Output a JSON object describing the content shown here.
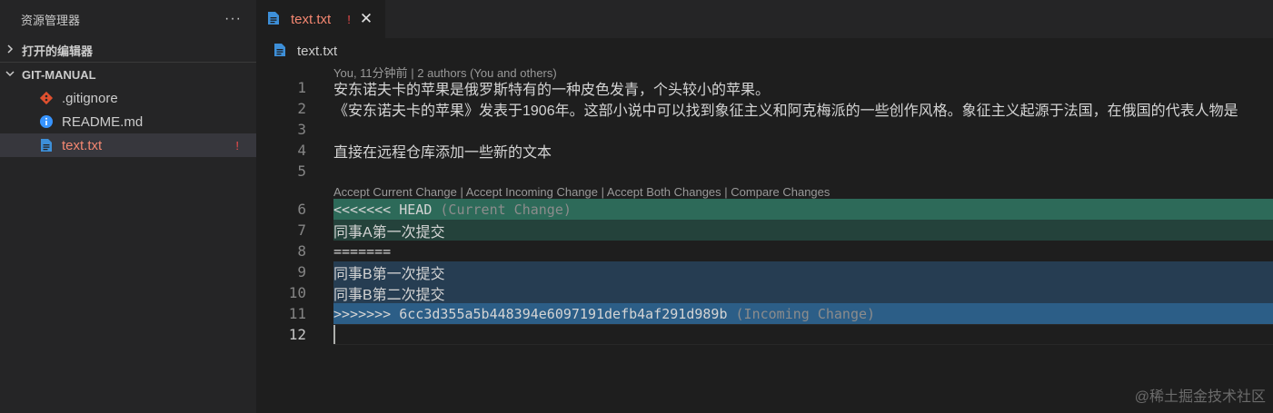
{
  "sidebar": {
    "title": "资源管理器",
    "more_label": "···",
    "open_editors": "打开的编辑器",
    "folder": "GIT-MANUAL",
    "files": [
      {
        "name": ".gitignore",
        "icon": "git-icon"
      },
      {
        "name": "README.md",
        "icon": "info-icon"
      },
      {
        "name": "text.txt",
        "icon": "file-icon",
        "status": "!"
      }
    ]
  },
  "tab": {
    "name": "text.txt",
    "status": "!",
    "close": "✕"
  },
  "breadcrumb": {
    "file": "text.txt"
  },
  "blame_lens": "You, 11分钟前 | 2 authors (You and others)",
  "conflict_lens": {
    "accept_current": "Accept Current Change",
    "accept_incoming": "Accept Incoming Change",
    "accept_both": "Accept Both Changes",
    "compare": "Compare Changes",
    "sep": " | "
  },
  "lines": [
    {
      "n": "1",
      "text": "安东诺夫卡的苹果是俄罗斯特有的一种皮色发青，个头较小的苹果。"
    },
    {
      "n": "2",
      "text": "《安东诺夫卡的苹果》发表于1906年。这部小说中可以找到象征主义和阿克梅派的一些创作风格。象征主义起源于法国，在俄国的代表人物是"
    },
    {
      "n": "3",
      "text": ""
    },
    {
      "n": "4",
      "text": "直接在远程仓库添加一些新的文本"
    },
    {
      "n": "5",
      "text": ""
    },
    {
      "n": "6",
      "text": "<<<<<<< HEAD",
      "hint": " (Current Change)"
    },
    {
      "n": "7",
      "text": "同事A第一次提交"
    },
    {
      "n": "8",
      "text": "======="
    },
    {
      "n": "9",
      "text": "同事B第一次提交"
    },
    {
      "n": "10",
      "text": "同事B第二次提交"
    },
    {
      "n": "11",
      "text": ">>>>>>> 6cc3d355a5b448394e6097191defb4af291d989b",
      "hint": " (Incoming Change)"
    },
    {
      "n": "12",
      "text": ""
    }
  ],
  "watermark": "@稀土掘金技术社区",
  "colors": {
    "current_header": "#2d6a59",
    "current_body": "#24423b",
    "incoming_body": "#263d52",
    "incoming_header": "#2c5e87",
    "modified": "#f48771"
  }
}
